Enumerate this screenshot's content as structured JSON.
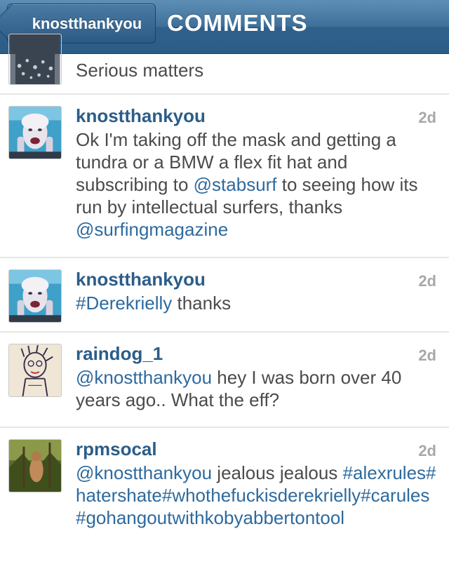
{
  "navbar": {
    "back_label": "knostthankyou",
    "title": "COMMENTS"
  },
  "comments": [
    {
      "username": "",
      "time": "",
      "text": [
        {
          "t": "Serious matters",
          "link": false
        }
      ],
      "avatar": "avatar-pattern-icon"
    },
    {
      "username": "knostthankyou",
      "time": "2d",
      "text": [
        {
          "t": "Ok I'm taking off the mask and getting a tundra or a BMW a flex fit hat and subscribing to ",
          "link": false
        },
        {
          "t": "@stabsurf",
          "link": true
        },
        {
          "t": " to seeing how its run by intellectual surfers, thanks ",
          "link": false
        },
        {
          "t": "@surfingmagazine",
          "link": true
        }
      ],
      "avatar": "avatar-mask-face-icon"
    },
    {
      "username": "knostthankyou",
      "time": "2d",
      "text": [
        {
          "t": "#Derekrielly",
          "link": true
        },
        {
          "t": " thanks",
          "link": false
        }
      ],
      "avatar": "avatar-mask-face-icon"
    },
    {
      "username": "raindog_1",
      "time": "2d",
      "text": [
        {
          "t": "@knostthankyou",
          "link": true
        },
        {
          "t": " hey I was born over 40 years ago.. What the eff?",
          "link": false
        }
      ],
      "avatar": "avatar-drawing-icon"
    },
    {
      "username": "rpmsocal",
      "time": "2d",
      "text": [
        {
          "t": "@knostthankyou",
          "link": true
        },
        {
          "t": " jealous jealous ",
          "link": false
        },
        {
          "t": "#alexrules#hatershate#whothefuckisderekrielly#carules#gohangoutwithkobyabbertontool",
          "link": true
        }
      ],
      "avatar": "avatar-forest-icon"
    }
  ],
  "colors": {
    "username": "#2b5d89",
    "link": "#2e6a9e",
    "body": "#4b4b4b",
    "time": "#a8a8a8"
  }
}
